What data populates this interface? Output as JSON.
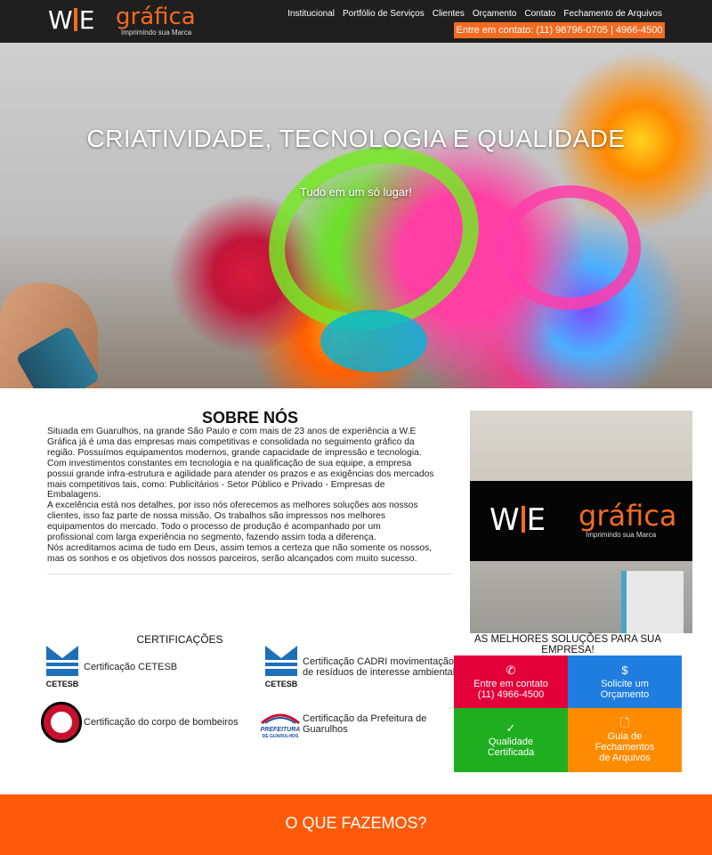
{
  "header": {
    "logo_we": "W E",
    "logo_grafica": "gráfica",
    "logo_tagline": "Imprimindo sua Marca",
    "nav": [
      "Institucional",
      "Portfólio de Serviços",
      "Clientes",
      "Orçamento",
      "Contato",
      "Fechamento de Arquivos"
    ],
    "contact_label": "Entre em contato: (11) 98796-0705 | 4966-4500"
  },
  "hero": {
    "title": "CRIATIVIDADE, TECNOLOGIA E QUALIDADE",
    "subtitle": "Tudo em um só lugar!"
  },
  "about": {
    "title": "SOBRE NÓS",
    "text": "Situada em Guarulhos, na grande São Paulo e com mais de 23 anos de experiência a W.E\nGráfica já é uma das empresas mais competitivas e consolidada no seguimento gráfico da\nregião. Possuímos equipamentos modernos, grande capacidade de impressão e tecnologia.\nCom investimentos constantes em tecnologia e na qualificação de sua equipe, a empresa\npossui grande infra-estrutura e agilidade para atender os prazos e as exigências dos mercados\nmais competitivos tais, como: Publicitários - Setor Público e Privado - Empresas de\nEmbalagens.\nA excelência está nos detalhes, por isso nós oferecemos as melhores soluções aos nossos\nclientes, isso faz parte de nossa missão. Os trabalhos são impressos nos melhores\nequipamentos do mercado. Todo o processo de produção é acompanhado por um\nprofissional com larga experiência no segmento, fazendo assim toda a diferença.\nNós acreditamos acima de tudo em Deus, assim temos a certeza que não somente os nossos,\nmas os sonhos e os objetivos dos nossos parceiros, serão alcançados com muito sucesso.",
    "photo_logo_we": "W E",
    "photo_logo_grafica": "gráfica",
    "photo_logo_tagline": "Imprimindo sua Marca"
  },
  "certifications": {
    "title": "CERTIFICAÇÕES",
    "items": [
      {
        "label": "Certificação CETESB",
        "logo_text": "CETESB"
      },
      {
        "label": "Certificação CADRI movimentação de resíduos de interesse ambiental",
        "logo_text": "CETESB"
      },
      {
        "label": "Certificação do corpo de bombeiros"
      },
      {
        "label": "Certificação da Prefeitura de Guarulhos",
        "logo_text": "PREFEITURA DE GUARULHOS"
      }
    ]
  },
  "solutions": {
    "title": "AS MELHORES SOLUÇÕES PARA SUA EMPRESA!",
    "tiles": [
      {
        "icon": "phone-icon",
        "label": "Entre em contato (11) 4966-4500",
        "color": "#e3003a"
      },
      {
        "icon": "dollar-icon",
        "label": "Solicite um Orçamento",
        "color": "#1f7de0"
      },
      {
        "icon": "check-icon",
        "label": "Qualidade Certificada",
        "color": "#1fae1f"
      },
      {
        "icon": "file-icon",
        "label": "Guia de Fechamentos de Arquivos",
        "color": "#ff8c00"
      }
    ]
  },
  "band": {
    "title": "O QUE FAZEMOS?",
    "color": "#ff5a0a"
  },
  "colors": {
    "accent": "#f36b21",
    "header_bg": "#1f1f1f"
  }
}
